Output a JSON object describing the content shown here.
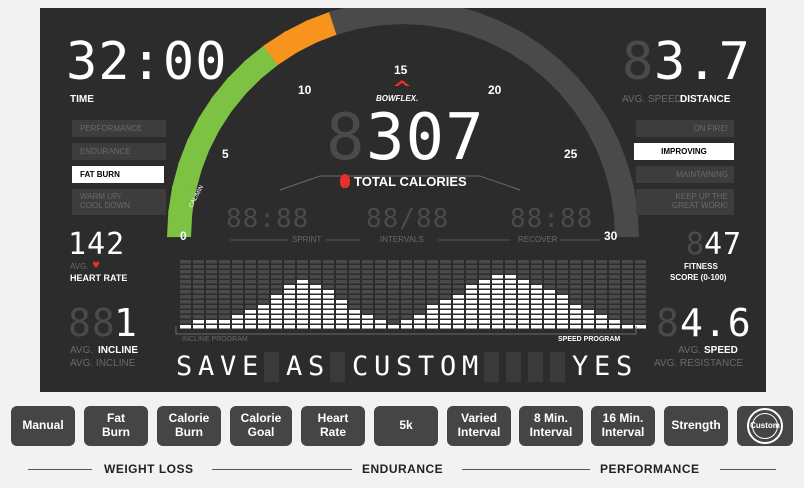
{
  "time": {
    "value": "32:00",
    "label": "TIME"
  },
  "distance": {
    "value": "3.7",
    "avg_label": "AVG. SPEED",
    "label": "DISTANCE"
  },
  "speed_dial": {
    "labels": [
      "0",
      "5",
      "10",
      "15",
      "20",
      "25",
      "30"
    ],
    "unit": "CAL/MIN",
    "active_green": 9,
    "active_orange": 3,
    "brand": "BOWFLEX."
  },
  "calories": {
    "value": "307",
    "label": "TOTAL CALORIES"
  },
  "left_panels": [
    "PERFORMANCE",
    "ENDURANCE",
    "FAT BURN",
    "WARM UP/\nCOOL DOWN"
  ],
  "right_panels": [
    "ON FIRE!",
    "IMPROVING",
    "MAINTAINING",
    "KEEP UP THE\nGREAT WORK!"
  ],
  "interval": {
    "sprint_label": "SPRINT",
    "intervals_label": "INTERVALS",
    "recover_label": "RECOVER",
    "sprint_ghost": "88:88",
    "intervals_ghost": "88/88",
    "recover_ghost": "88:88"
  },
  "heart_rate": {
    "value": "142",
    "avg_label": "AVG.",
    "label": "HEART RATE"
  },
  "fitness": {
    "value": "47",
    "label": "FITNESS",
    "sublabel": "SCORE (0-100)"
  },
  "incline": {
    "value": "1",
    "avg_label": "AVG.",
    "label": "INCLINE",
    "sub_label": "AVG. INCLINE"
  },
  "speed": {
    "value": "4.6",
    "avg_label": "AVG.",
    "label": "SPEED",
    "sub_label": "AVG. RESISTANCE"
  },
  "profile": {
    "incline_label": "INCLINE PROGRAM",
    "speed_label": "SPEED PROGRAM",
    "levels": [
      1,
      2,
      2,
      2,
      3,
      4,
      5,
      7,
      9,
      10,
      9,
      8,
      6,
      4,
      3,
      2,
      1,
      2,
      3,
      5,
      6,
      7,
      9,
      10,
      11,
      11,
      10,
      9,
      8,
      7,
      5,
      4,
      3,
      2,
      1,
      1
    ]
  },
  "message": {
    "text": "SAVE AS CUSTOM    YES"
  },
  "colors": {
    "green": "#7dc242",
    "orange": "#f7941d",
    "ghost": "#4a4a4a",
    "red": "#e8302b"
  },
  "buttons": [
    "Manual",
    "Fat\nBurn",
    "Calorie\nBurn",
    "Calorie\nGoal",
    "Heart\nRate",
    "5k",
    "Varied\nInterval",
    "8 Min.\nInterval",
    "16 Min.\nInterval",
    "Strength",
    "Custom"
  ],
  "groups": [
    "WEIGHT LOSS",
    "ENDURANCE",
    "PERFORMANCE"
  ]
}
